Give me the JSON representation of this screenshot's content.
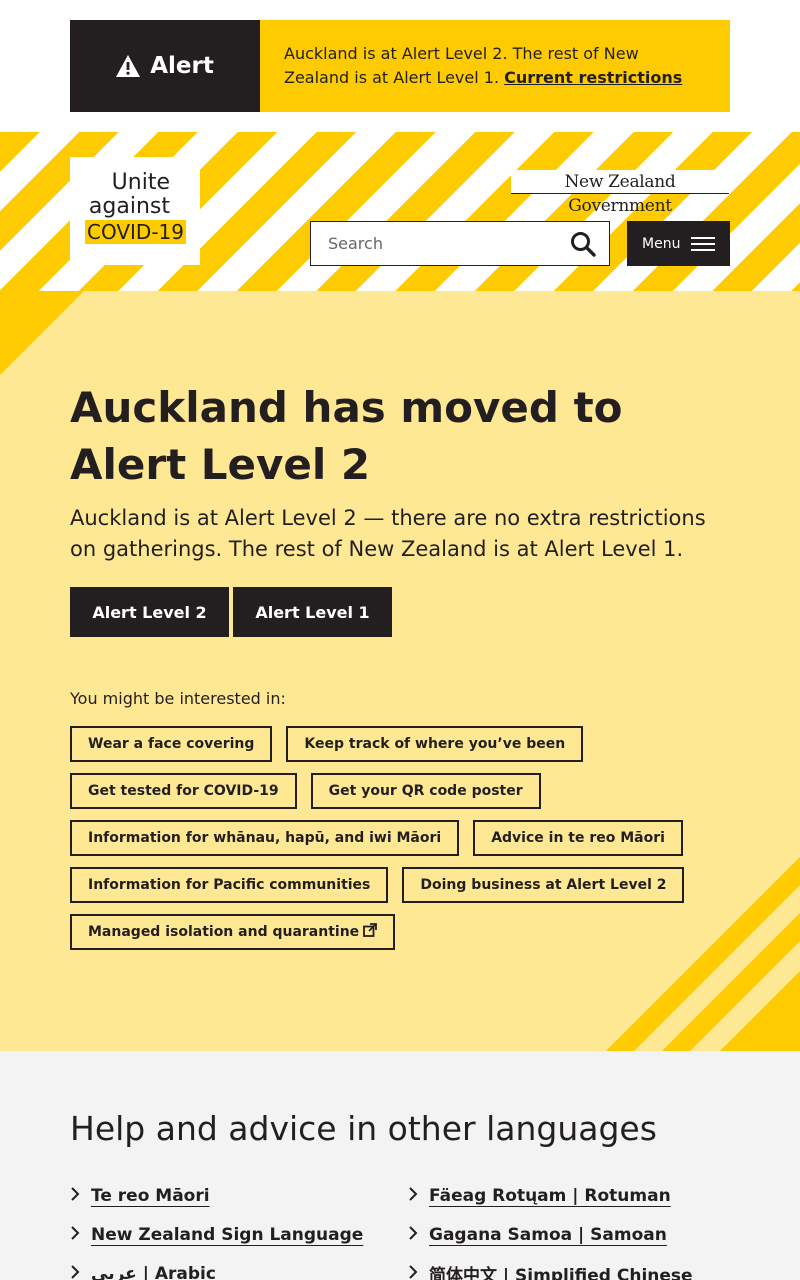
{
  "alert": {
    "label": "Alert",
    "message": "Auckland is at Alert Level 2. The rest of New Zealand is at Alert Level 1.",
    "link": "Current restrictions"
  },
  "header": {
    "logo": {
      "line1": "Unite",
      "line2": "against",
      "line3": "COVID-19"
    },
    "govt": "New Zealand Government",
    "search_placeholder": "Search",
    "menu_label": "Menu"
  },
  "hero": {
    "title": "Auckland has moved to Alert Level 2",
    "subtitle": "Auckland is at Alert Level 2 — there are no extra restrictions on gatherings. The rest of New Zealand is at Alert Level 1.",
    "buttons": [
      "Alert Level 2",
      "Alert Level 1"
    ],
    "interest_label": "You might be interested in:",
    "chips": [
      [
        "Wear a face covering",
        "Keep track of where you’ve been"
      ],
      [
        "Get tested for COVID-19",
        "Get your QR code poster"
      ],
      [
        "Information for whānau, hapū, and iwi Māori",
        "Advice in te reo Māori"
      ],
      [
        "Information for Pacific communities",
        "Doing business at Alert Level 2"
      ],
      [
        "Managed isolation and quarantine"
      ]
    ]
  },
  "languages": {
    "title": "Help and advice in other languages",
    "left": [
      "Te reo Māori",
      "New Zealand Sign Language",
      "عربي | Arabic"
    ],
    "right": [
      "Fäeag Rotųam | Rotuman",
      "Gagana Samoa | Samoan",
      "简体中文 | Simplified Chinese"
    ]
  },
  "colors": {
    "yellow": "#fecb00",
    "light_yellow": "#fee894",
    "dark": "#231f20",
    "grey_bg": "#f3f3f3"
  }
}
